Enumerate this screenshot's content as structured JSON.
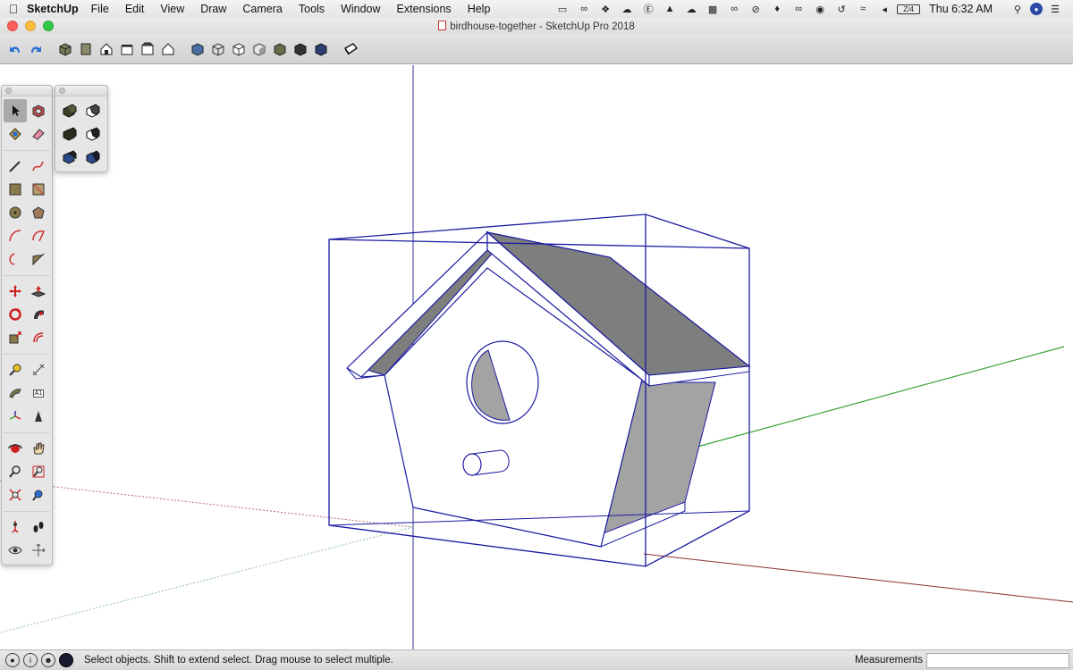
{
  "menubar": {
    "app_name": "SketchUp",
    "menus": [
      "File",
      "Edit",
      "View",
      "Draw",
      "Camera",
      "Tools",
      "Window",
      "Extensions",
      "Help"
    ],
    "clock": "Thu 6:32 AM",
    "battery_label": "Z/4"
  },
  "window": {
    "title": "birdhouse-together - SketchUp Pro 2018"
  },
  "toolbar": {
    "icons": [
      "undo-icon",
      "redo-icon",
      "iso-view-icon",
      "top-view-icon",
      "front-view-icon",
      "right-view-icon",
      "back-view-icon",
      "left-view-icon",
      "xray-style-icon",
      "wireframe-style-icon",
      "hidden-line-style-icon",
      "shaded-style-icon",
      "shaded-texture-style-icon",
      "monochrome-style-icon",
      "3d-warehouse-icon"
    ]
  },
  "large_toolset": {
    "tools": [
      "select",
      "make-component",
      "paint-bucket",
      "eraser",
      "line",
      "freehand",
      "rectangle",
      "rotated-rectangle",
      "circle",
      "polygon",
      "arc",
      "pie",
      "two-point-arc",
      "three-point-arc",
      "move",
      "push-pull",
      "rotate",
      "follow-me",
      "scale",
      "offset",
      "tape-measure",
      "dimension",
      "protractor",
      "text",
      "axes",
      "3d-text",
      "orbit",
      "pan",
      "zoom",
      "zoom-window",
      "zoom-extents",
      "previous-view",
      "position-camera",
      "walk",
      "look-around",
      "section-plane"
    ],
    "text_tool_label": "A1"
  },
  "solid_tools": {
    "tools": [
      "outer-shell",
      "intersect",
      "union",
      "subtract",
      "trim",
      "split"
    ]
  },
  "status": {
    "message": "Select objects. Shift to extend select. Drag mouse to select multiple.",
    "measurements_label": "Measurements",
    "measurements_value": ""
  },
  "colors": {
    "selection_blue": "#1a1aa0",
    "roof_gray": "#7e7e7e",
    "side_gray": "#a3a3a3",
    "red_axis": "#8b3030",
    "green_axis": "#3aa33a",
    "blue_axis": "#3030a0"
  }
}
